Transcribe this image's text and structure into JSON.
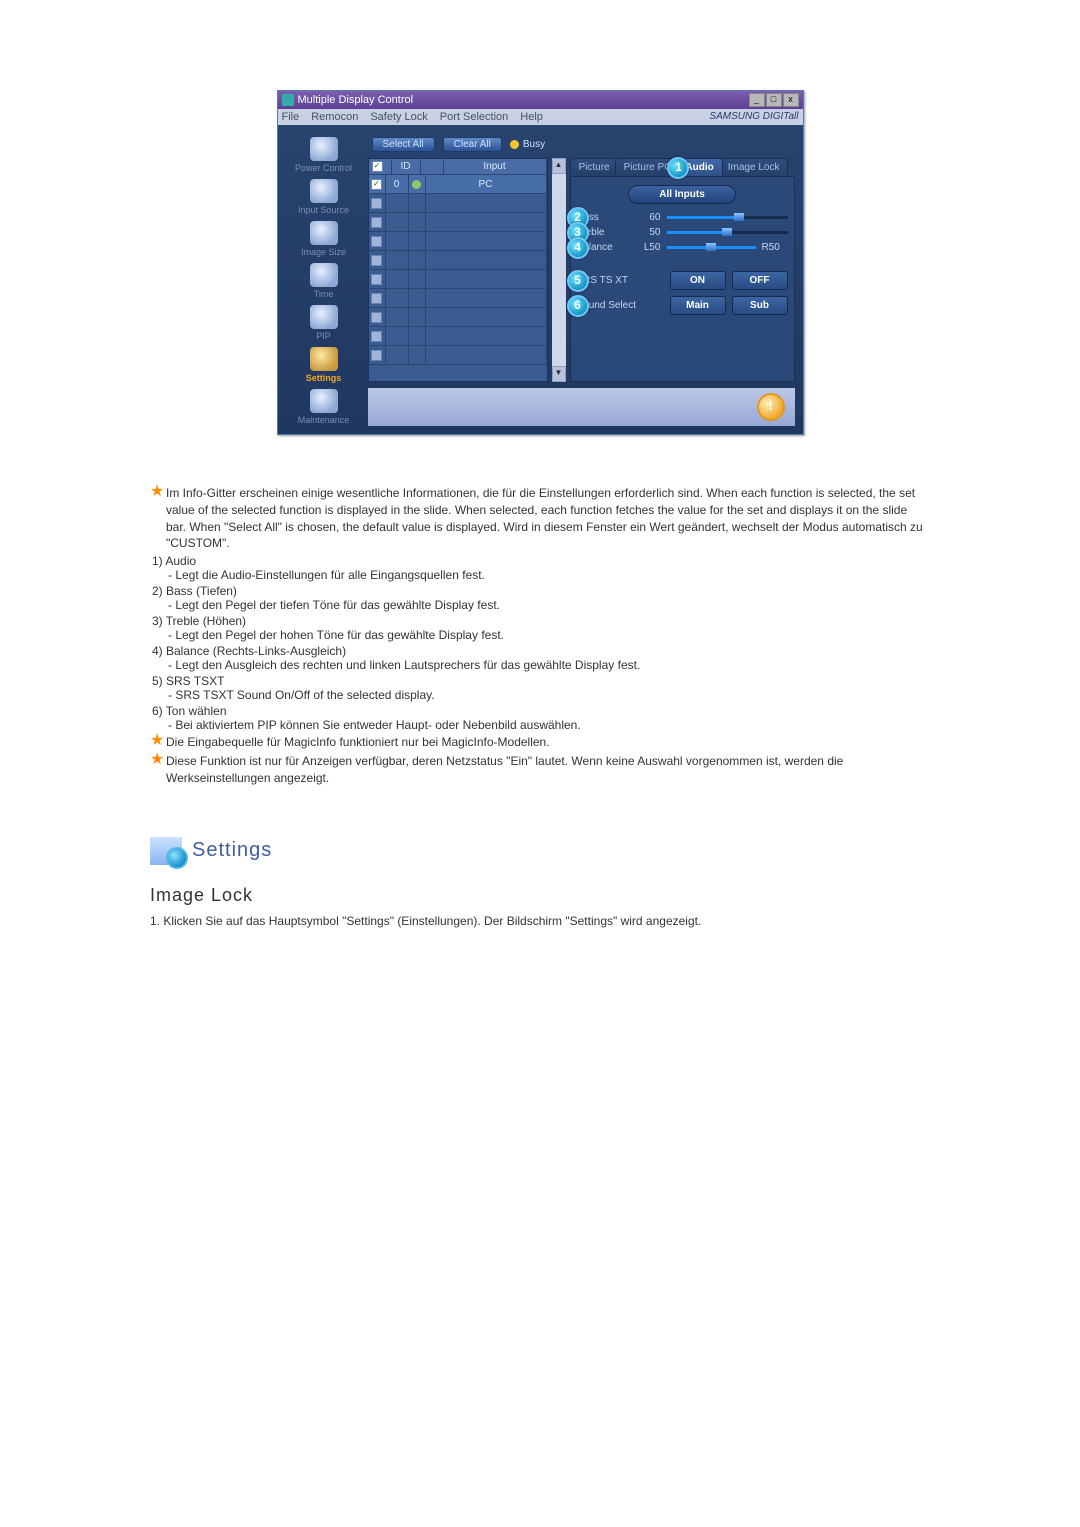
{
  "window": {
    "title": "Multiple Display Control",
    "menu": [
      "File",
      "Remocon",
      "Safety Lock",
      "Port Selection",
      "Help"
    ],
    "brand": "SAMSUNG DIGITall"
  },
  "sidebar": {
    "items": [
      {
        "label": "Power Control"
      },
      {
        "label": "Input Source"
      },
      {
        "label": "Image Size"
      },
      {
        "label": "Time"
      },
      {
        "label": "PIP"
      },
      {
        "label": "Settings"
      },
      {
        "label": "Maintenance"
      }
    ]
  },
  "toolbar": {
    "select_all": "Select All",
    "clear_all": "Clear All",
    "busy": "Busy"
  },
  "grid": {
    "headers": {
      "checkbox": "",
      "id": "ID",
      "icon": "",
      "input": "Input"
    },
    "first_row": {
      "id": "0",
      "input": "PC"
    },
    "row_count": 10
  },
  "tabs": {
    "items": [
      "Picture",
      "Picture PC",
      "Audio",
      "Image Lock"
    ],
    "active_index": 2
  },
  "panel": {
    "all_inputs": "All Inputs",
    "sliders": [
      {
        "marker": "2",
        "label": "Bass",
        "value": "60",
        "fill": 60,
        "thumb": 60
      },
      {
        "marker": "3",
        "label": "Treble",
        "value": "50",
        "fill": 50,
        "thumb": 50
      },
      {
        "marker": "4",
        "label": "Balance",
        "value": "L50",
        "value_right": "R50",
        "fill": 100,
        "thumb": 50
      }
    ],
    "button_rows": [
      {
        "marker": "5",
        "label": "SRS TS XT",
        "b1": "ON",
        "b2": "OFF"
      },
      {
        "marker": "6",
        "label": "Sound Select",
        "b1": "Main",
        "b2": "Sub"
      }
    ],
    "tab_marker": "1"
  },
  "notes": {
    "star_intro": "Im Info-Gitter erscheinen einige wesentliche Informationen, die für die Einstellungen erforderlich sind. When each function is selected, the set value of the selected function is displayed in the slide. When selected, each function fetches the value for the set and displays it on the slide bar. When \"Select All\" is chosen, the default value is displayed. Wird in diesem Fenster ein Wert geändert, wechselt der Modus automatisch zu \"CUSTOM\".",
    "list": [
      {
        "n": "1)",
        "h": "Audio",
        "s": "- Legt die Audio-Einstellungen für alle Eingangsquellen fest."
      },
      {
        "n": "2)",
        "h": "Bass (Tiefen)",
        "s": "- Legt den Pegel der tiefen Töne für das gewählte Display fest."
      },
      {
        "n": "3)",
        "h": "Treble (Höhen)",
        "s": "- Legt den Pegel der hohen Töne für das gewählte Display fest."
      },
      {
        "n": "4)",
        "h": "Balance (Rechts-Links-Ausgleich)",
        "s": "- Legt den Ausgleich des rechten und linken Lautsprechers für das gewählte Display fest."
      },
      {
        "n": "5)",
        "h": "SRS TSXT",
        "s": "- SRS TSXT Sound On/Off of the selected display."
      },
      {
        "n": "6)",
        "h": "Ton wählen",
        "s": "- Bei aktiviertem PIP können Sie entweder Haupt- oder Nebenbild auswählen."
      }
    ],
    "star_foot1": "Die Eingabequelle für MagicInfo funktioniert nur bei MagicInfo-Modellen.",
    "star_foot2": "Diese Funktion ist nur für Anzeigen verfügbar, deren Netzstatus \"Ein\" lautet. Wenn keine Auswahl vorgenommen ist, werden die Werkseinstellungen angezeigt."
  },
  "section": {
    "title": "Settings",
    "subhead": "Image Lock",
    "step1": "1. Klicken Sie auf das Hauptsymbol \"Settings\" (Einstellungen). Der Bildschirm \"Settings\" wird angezeigt."
  }
}
